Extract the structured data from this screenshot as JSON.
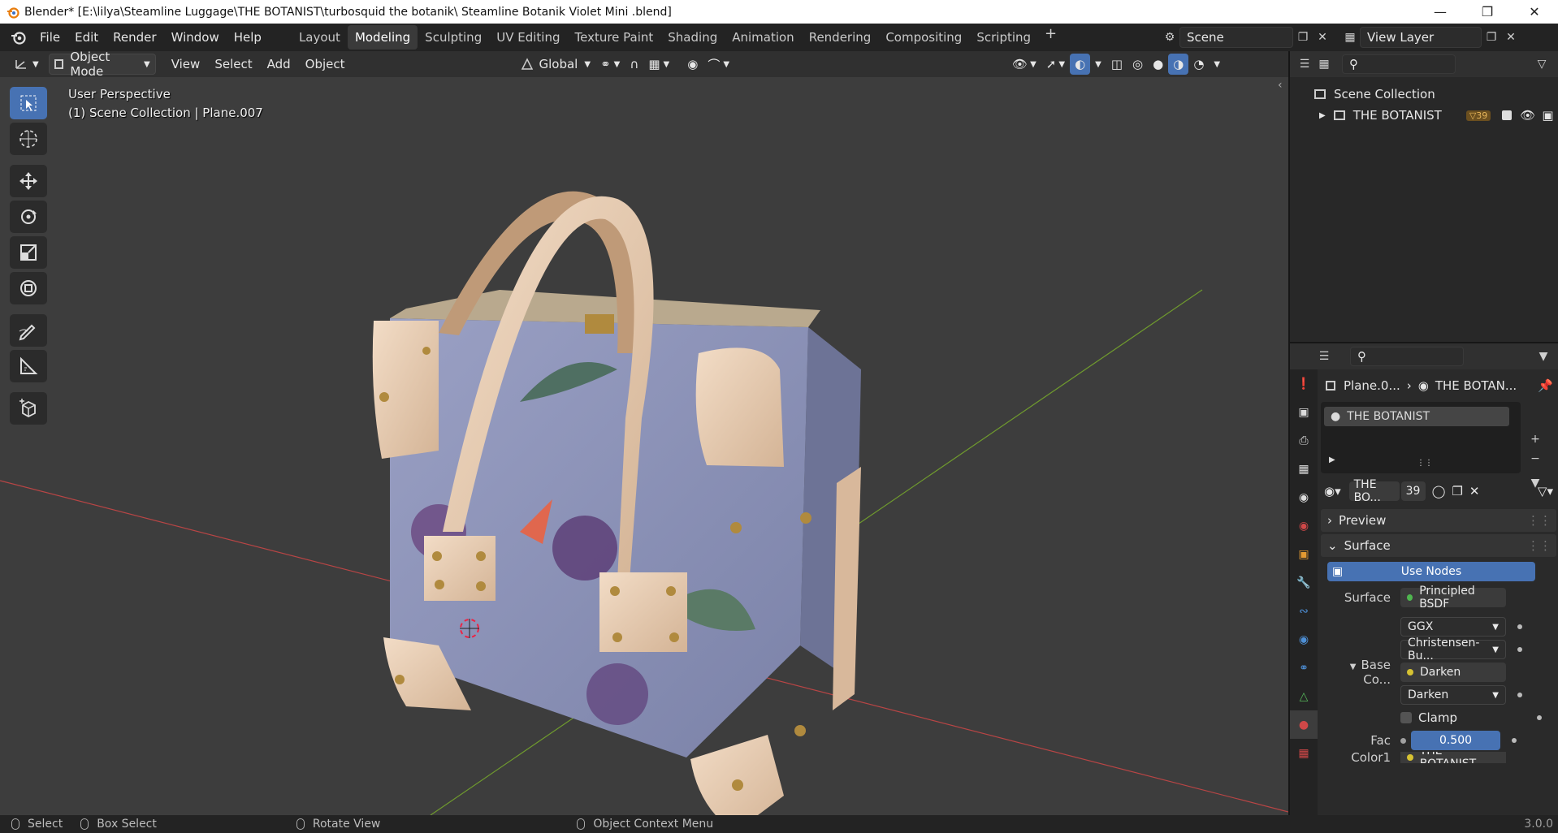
{
  "window": {
    "title": "Blender* [E:\\lilya\\Steamline Luggage\\THE BOTANIST\\turbosquid the botanik\\ Steamline Botanik Violet Mini  .blend]"
  },
  "menu": [
    "File",
    "Edit",
    "Render",
    "Window",
    "Help"
  ],
  "workspaces": {
    "tabs": [
      "Layout",
      "Modeling",
      "Sculpting",
      "UV Editing",
      "Texture Paint",
      "Shading",
      "Animation",
      "Rendering",
      "Compositing",
      "Scripting"
    ],
    "active": "Modeling",
    "add_label": "+"
  },
  "scene": {
    "name": "Scene",
    "view_layer": "View Layer"
  },
  "viewport_header": {
    "mode": "Object Mode",
    "menus": [
      "View",
      "Select",
      "Add",
      "Object"
    ],
    "orientation": "Global"
  },
  "viewport": {
    "perspective_label": "User Perspective",
    "collection_label": "(1) Scene Collection | Plane.007"
  },
  "outliner": {
    "root": "Scene Collection",
    "collection": "THE BOTANIST",
    "badge_count": "39"
  },
  "properties": {
    "breadcrumb_object": "Plane.0...",
    "breadcrumb_material": "THE BOTAN...",
    "material_slot": "THE BOTANIST",
    "material_name": "THE BO...",
    "users": "39",
    "preview_label": "Preview",
    "surface_panel": "Surface",
    "use_nodes": "Use Nodes",
    "surface_label": "Surface",
    "surface_value": "Principled BSDF",
    "distribution": "GGX",
    "subsurface": "Christensen-Bu...",
    "base_color_label": "Base Co...",
    "base_color_value": "Darken",
    "blend_mode": "Darken",
    "clamp_label": "Clamp",
    "fac_label": "Fac",
    "fac_value": "0.500",
    "color1_label": "Color1",
    "color1_value": "THE BOTANIST"
  },
  "statusbar": {
    "select": "Select",
    "box_select": "Box Select",
    "rotate_view": "Rotate View",
    "context_menu": "Object Context Menu",
    "version": "3.0.0"
  },
  "colors": {
    "accent": "#4772b3",
    "viewport_bg": "#3d3d3d",
    "bag_fabric": "#8b93b8",
    "leather": "#e3c7ad",
    "brass": "#b08a3e"
  }
}
